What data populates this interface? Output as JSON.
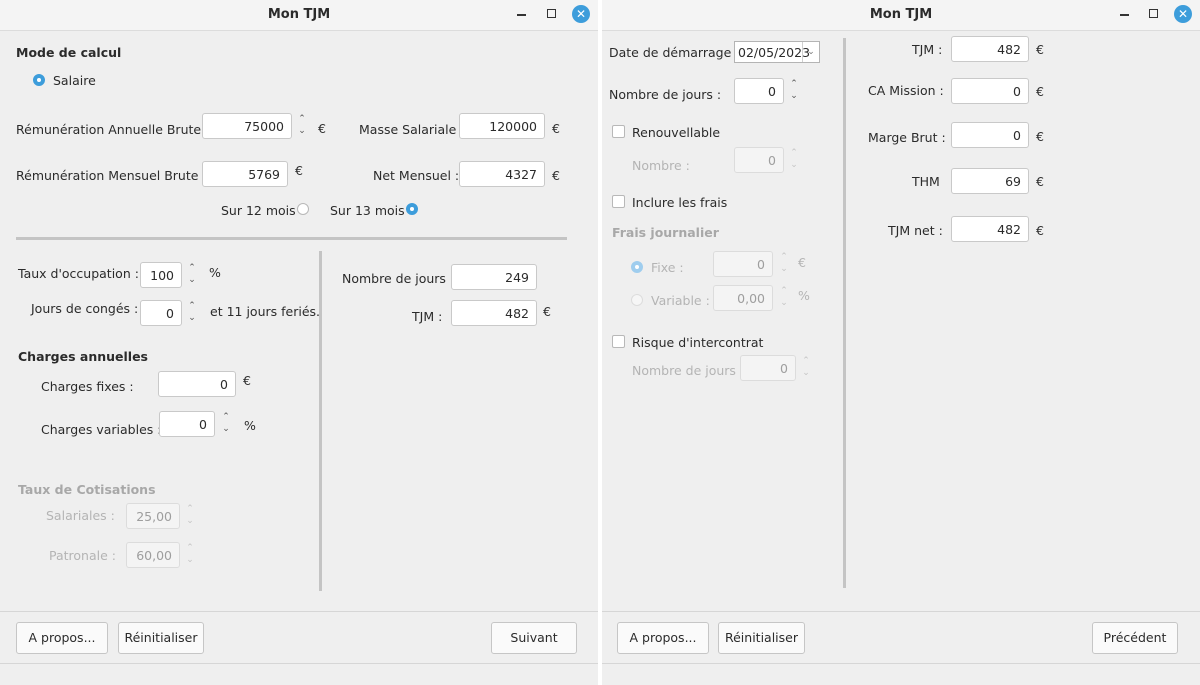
{
  "currency": "€",
  "percent": "%",
  "spin_glyphs": {
    "up": "⌃",
    "down": "⌄"
  },
  "window": {
    "title": "Mon TJM",
    "close_glyph": "✕"
  },
  "left": {
    "mode_heading": "Mode de calcul",
    "mode_option": "Salaire",
    "annual_gross_label": "Rémunération Annuelle Brute :",
    "annual_gross_value": "75000",
    "payroll_label": "Masse Salariale :",
    "payroll_value": "120000",
    "monthly_gross_label": "Rémunération Mensuel Brute :",
    "monthly_gross_value": "5769",
    "net_monthly_label": "Net Mensuel :",
    "net_monthly_value": "4327",
    "months_12_label": "Sur 12 mois",
    "months_13_label": "Sur 13 mois",
    "selected_months": "Sur 13 mois",
    "occupation_label": "Taux d'occupation :",
    "occupation_value": "100",
    "holidays_label": "Jours de congés :",
    "holidays_value": "0",
    "public_holidays_text": "et 11 jours feriés.",
    "days_label": "Nombre de jours :",
    "days_value": "249",
    "tjm_label": "TJM :",
    "tjm_value": "482",
    "charges_heading": "Charges annuelles",
    "fixed_charges_label": "Charges fixes :",
    "fixed_charges_value": "0",
    "variable_charges_label": "Charges variables :",
    "variable_charges_value": "0",
    "cotisations_heading": "Taux de Cotisations",
    "salariales_label": "Salariales :",
    "salariales_value": "25,00",
    "patronale_label": "Patronale :",
    "patronale_value": "60,00",
    "about_button": "A propos...",
    "reset_button": "Réinitialiser",
    "next_button": "Suivant"
  },
  "right": {
    "start_date_label": "Date de démarrage :",
    "start_date_value": "02/05/2023",
    "days_label": "Nombre de jours :",
    "days_value": "0",
    "renewable_label": "Renouvellable",
    "renewable_count_label": "Nombre :",
    "renewable_count_value": "0",
    "include_fees_label": "Inclure les frais",
    "daily_fees_heading": "Frais journalier",
    "fixed_label": "Fixe :",
    "fixed_value": "0",
    "variable_label": "Variable :",
    "variable_value": "0,00",
    "selected_fee_mode": "Fixe",
    "intercontract_label": "Risque d'intercontrat",
    "intercontract_days_label": "Nombre de jours :",
    "intercontract_days_value": "0",
    "tjm_label": "TJM :",
    "tjm_value": "482",
    "ca_label": "CA Mission :",
    "ca_value": "0",
    "margin_label": "Marge Brut :",
    "margin_value": "0",
    "thm_label": "THM",
    "thm_value": "69",
    "tjm_net_label": "TJM net :",
    "tjm_net_value": "482",
    "about_button": "A propos...",
    "reset_button": "Réinitialiser",
    "prev_button": "Précédent"
  }
}
